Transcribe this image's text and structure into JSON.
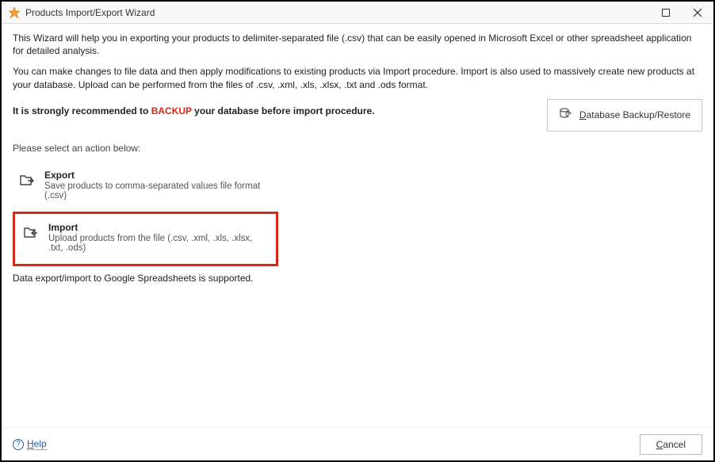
{
  "window": {
    "title": "Products Import/Export Wizard"
  },
  "intro": {
    "p1": "This Wizard will help you in exporting your products to delimiter-separated file (.csv) that can be easily opened in Microsoft Excel or other spreadsheet application for detailed analysis.",
    "p2": "You can make changes to file data and then apply modifications to existing products via Import procedure. Import is also used to massively create new products at your database. Upload can be performed from the files of .csv, .xml, .xls, .xlsx, .txt and .ods format."
  },
  "recommend": {
    "prefix": "It is strongly recommended to ",
    "backup_word": "BACKUP",
    "suffix": " your database before import procedure."
  },
  "backup_button": {
    "label": "Database Backup/Restore"
  },
  "select_label": "Please select an action below:",
  "options": {
    "export": {
      "title": "Export",
      "desc": "Save products to comma-separated values file format (.csv)"
    },
    "import": {
      "title": "Import",
      "desc": "Upload products from the file (.csv, .xml, .xls, .xlsx, .txt, .ods)"
    }
  },
  "gs_note": "Data export/import to Google Spreadsheets is supported.",
  "footer": {
    "help": "Help",
    "cancel": "Cancel"
  }
}
